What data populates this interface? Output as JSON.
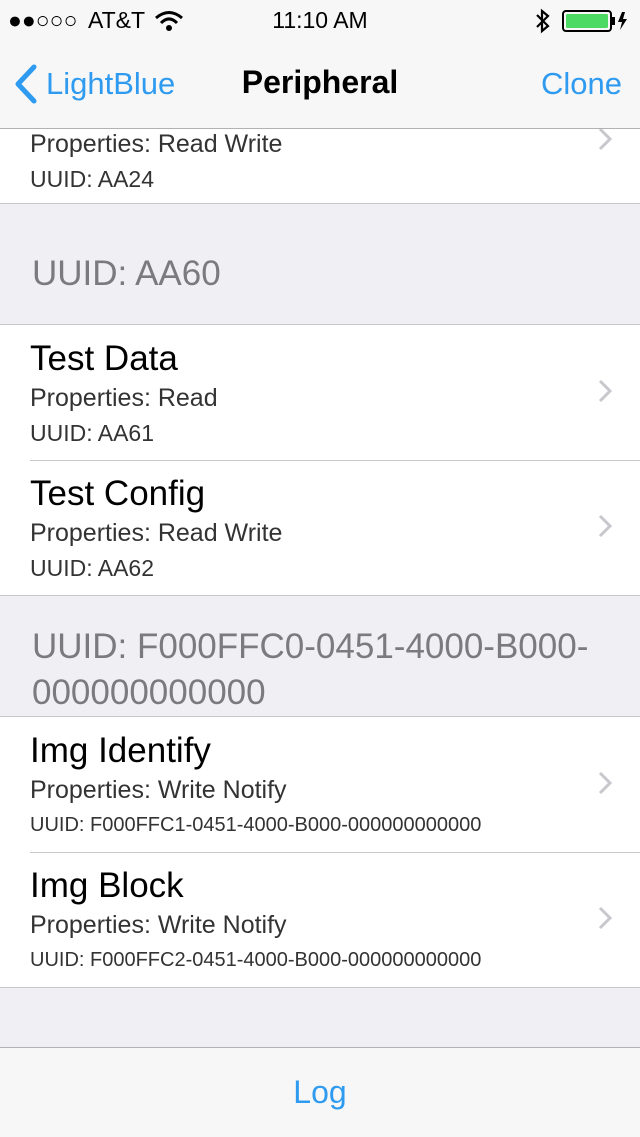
{
  "status": {
    "carrier": "AT&T",
    "time": "11:10 AM",
    "signal_dots": "●●○○○",
    "icons": [
      "wifi-icon",
      "bluetooth-icon",
      "battery-icon"
    ]
  },
  "nav": {
    "back_label": "LightBlue",
    "title": "Peripheral",
    "right_label": "Clone"
  },
  "partial_row": {
    "properties": "Properties: Read Write",
    "uuid": "UUID: AA24"
  },
  "sections": [
    {
      "header": "UUID: AA60",
      "rows": [
        {
          "title": "Test Data",
          "properties": "Properties: Read",
          "uuid": "UUID: AA61"
        },
        {
          "title": "Test Config",
          "properties": "Properties: Read Write",
          "uuid": "UUID: AA62"
        }
      ]
    },
    {
      "header": "UUID: F000FFC0-0451-4000-B000-000000000000",
      "rows": [
        {
          "title": "Img Identify",
          "properties": "Properties: Write Notify",
          "uuid": "UUID: F000FFC1-0451-4000-B000-000000000000"
        },
        {
          "title": "Img Block",
          "properties": "Properties: Write Notify",
          "uuid": "UUID: F000FFC2-0451-4000-B000-000000000000"
        }
      ]
    }
  ],
  "toolbar": {
    "log_label": "Log"
  },
  "colors": {
    "accent": "#2f9bf0",
    "battery": "#4cd964",
    "background": "#efeff4"
  }
}
